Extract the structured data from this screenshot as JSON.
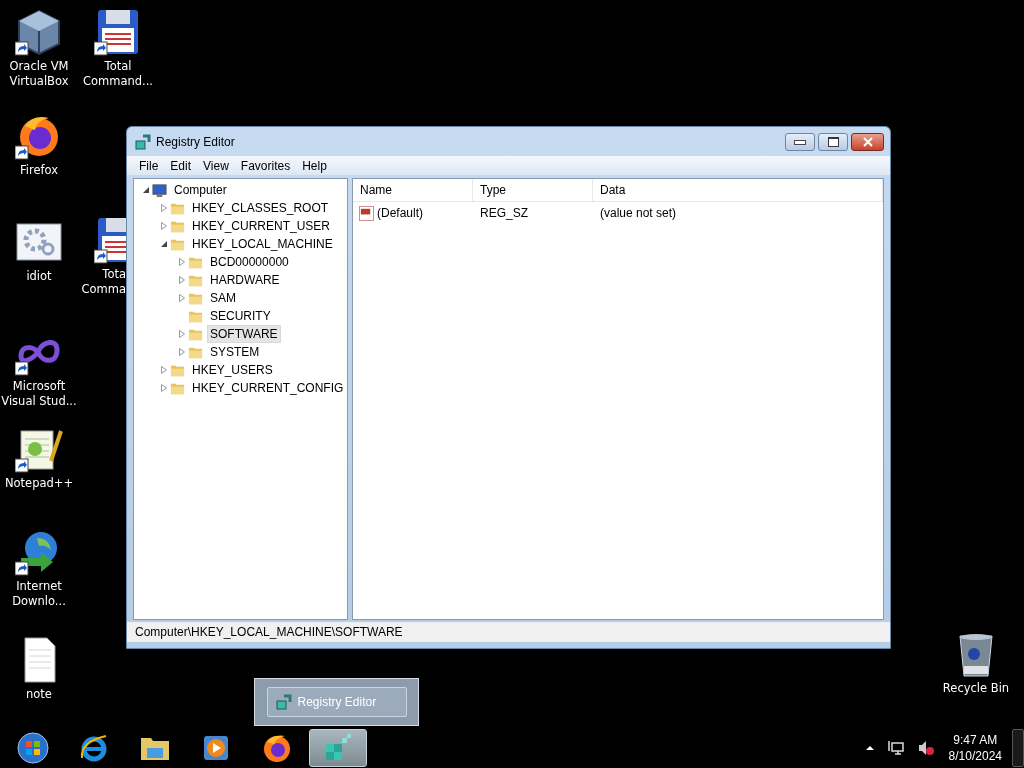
{
  "desktop_icons": [
    {
      "kind": "virtualbox",
      "shortcut": true,
      "label": [
        "Oracle VM",
        "VirtualBox"
      ]
    },
    {
      "kind": "total_commander",
      "shortcut": true,
      "label": [
        "Total",
        "Command..."
      ]
    },
    {
      "kind": "firefox",
      "shortcut": true,
      "label": [
        "Firefox"
      ]
    },
    {
      "kind": "settings_file",
      "shortcut": false,
      "label": [
        "idiot"
      ]
    },
    {
      "kind": "total_commander",
      "shortcut": true,
      "label": [
        "Tota",
        "Comma"
      ]
    },
    {
      "kind": "visual_studio",
      "shortcut": true,
      "label": [
        "Microsoft",
        "Visual Stud..."
      ]
    },
    {
      "kind": "notepadpp",
      "shortcut": true,
      "label": [
        "Notepad++"
      ]
    },
    {
      "kind": "download_manager",
      "shortcut": true,
      "label": [
        "Internet",
        "Downlo..."
      ]
    },
    {
      "kind": "text_file",
      "shortcut": false,
      "label": [
        "note"
      ]
    },
    {
      "kind": "recycle_bin",
      "shortcut": false,
      "label": [
        "Recycle Bin"
      ]
    }
  ],
  "window": {
    "title": "Registry Editor",
    "menu": [
      "File",
      "Edit",
      "View",
      "Favorites",
      "Help"
    ],
    "tree": {
      "label": "Computer",
      "expanded": true,
      "selected": false,
      "children": [
        {
          "label": "HKEY_CLASSES_ROOT",
          "expanded": false,
          "selected": false,
          "has_children": true
        },
        {
          "label": "HKEY_CURRENT_USER",
          "expanded": false,
          "selected": false,
          "has_children": true
        },
        {
          "label": "HKEY_LOCAL_MACHINE",
          "expanded": true,
          "selected": false,
          "has_children": true,
          "children": [
            {
              "label": "BCD00000000",
              "expanded": false,
              "selected": false,
              "has_children": true
            },
            {
              "label": "HARDWARE",
              "expanded": false,
              "selected": false,
              "has_children": true
            },
            {
              "label": "SAM",
              "expanded": false,
              "selected": false,
              "has_children": true
            },
            {
              "label": "SECURITY",
              "expanded": false,
              "selected": false,
              "has_children": false
            },
            {
              "label": "SOFTWARE",
              "expanded": false,
              "selected": true,
              "has_children": true
            },
            {
              "label": "SYSTEM",
              "expanded": false,
              "selected": false,
              "has_children": true
            }
          ]
        },
        {
          "label": "HKEY_USERS",
          "expanded": false,
          "selected": false,
          "has_children": true
        },
        {
          "label": "HKEY_CURRENT_CONFIG",
          "expanded": false,
          "selected": false,
          "has_children": true
        }
      ]
    },
    "list": {
      "columns": [
        "Name",
        "Type",
        "Data"
      ],
      "rows": [
        {
          "name": "(Default)",
          "type": "REG_SZ",
          "data": "(value not set)"
        }
      ]
    },
    "status_bar": "Computer\\HKEY_LOCAL_MACHINE\\SOFTWARE"
  },
  "taskbar": {
    "items": [
      {
        "kind": "start",
        "active": false
      },
      {
        "kind": "internet_explorer",
        "active": false
      },
      {
        "kind": "file_explorer",
        "active": false
      },
      {
        "kind": "media_player",
        "active": false
      },
      {
        "kind": "firefox",
        "active": false
      },
      {
        "kind": "registry",
        "active": true
      }
    ],
    "thumbnail": {
      "title": "Registry Editor"
    },
    "clock": {
      "time": "9:47 AM",
      "date": "8/10/2024"
    }
  }
}
